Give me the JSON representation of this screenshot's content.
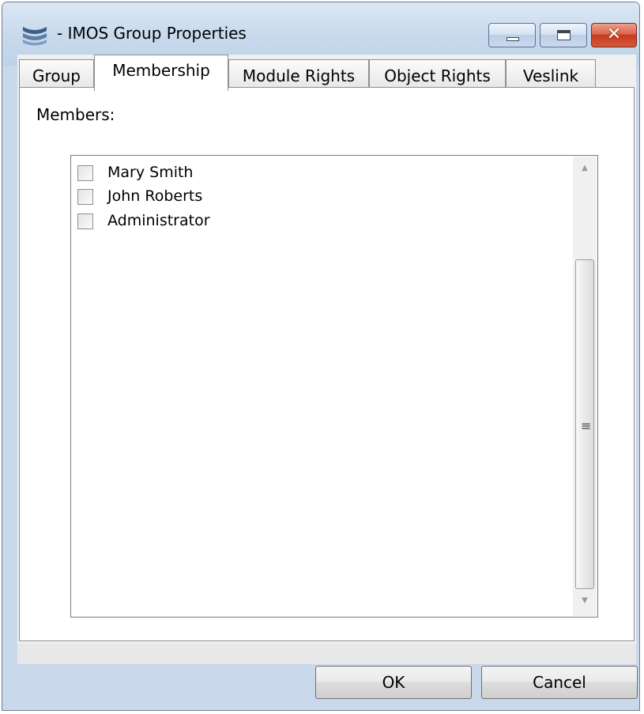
{
  "window": {
    "title": "- IMOS Group Properties",
    "close_glyph": "✕"
  },
  "tabs": [
    {
      "label": "Group",
      "active": false
    },
    {
      "label": "Membership",
      "active": true
    },
    {
      "label": "Module Rights",
      "active": false
    },
    {
      "label": "Object Rights",
      "active": false
    },
    {
      "label": "Veslink",
      "active": false
    }
  ],
  "membership": {
    "members_label": "Members:",
    "members": [
      {
        "name": "Mary Smith",
        "checked": false
      },
      {
        "name": "John Roberts",
        "checked": false
      },
      {
        "name": "Administrator",
        "checked": false
      }
    ],
    "scroll_up": "▲",
    "scroll_down": "▼",
    "grip": "≡"
  },
  "buttons": {
    "ok_label": "OK",
    "cancel_label": "Cancel"
  }
}
